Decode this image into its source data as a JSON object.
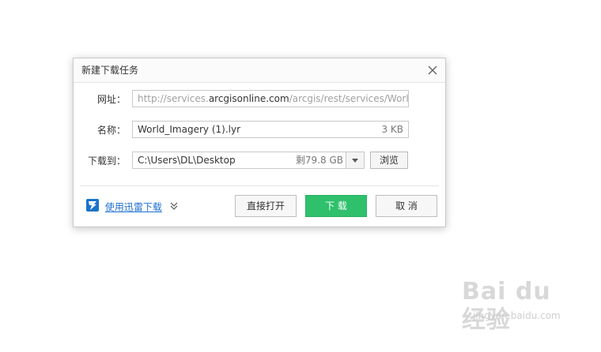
{
  "dialog": {
    "title": "新建下载任务",
    "url": {
      "label": "网址：",
      "prefix": "http://services.",
      "host": "arcgisonline.com",
      "suffix": "/arcgis/rest/services/World"
    },
    "name": {
      "label": "名称：",
      "value": "World_Imagery (1).lyr",
      "size": "3 KB"
    },
    "path": {
      "label": "下载到：",
      "value": "C:\\Users\\DL\\Desktop",
      "free": "剩79.8 GB"
    },
    "browse_label": "浏览",
    "thunder_link": "使用迅雷下载",
    "buttons": {
      "open": "直接打开",
      "download": "下 载",
      "cancel": "取 消"
    }
  },
  "watermark": {
    "text": "Bai du 经验",
    "sub": "jingyan.baidu.com"
  },
  "colors": {
    "download_green": "#2fc06c",
    "link_blue": "#1f6fd1"
  }
}
